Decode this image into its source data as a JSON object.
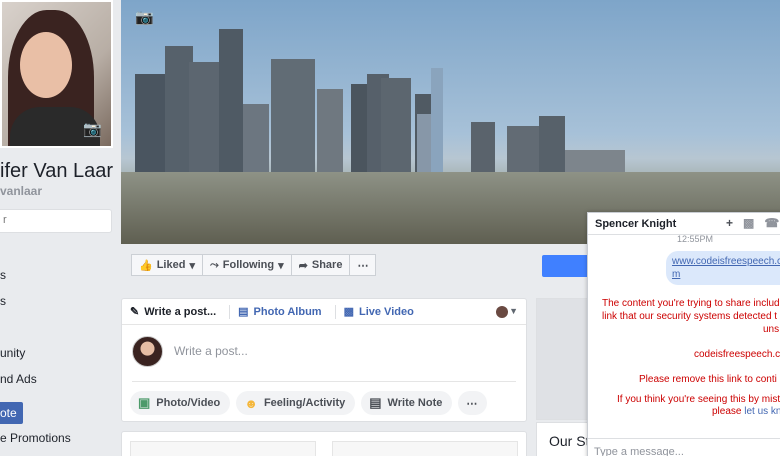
{
  "profile": {
    "name": "ifer Van Laar",
    "handle": "vanlaar",
    "search_placeholder": "r"
  },
  "left_nav": {
    "items": [
      "s",
      "s",
      "",
      "unity",
      "nd Ads"
    ],
    "promote_label": "ote",
    "promotions_label": "e Promotions"
  },
  "actions": {
    "liked": "Liked",
    "following": "Following",
    "share": "Share",
    "more": "⋯"
  },
  "composer": {
    "tab_write": "Write a post...",
    "tab_album": "Photo Album",
    "tab_video": "Live Video",
    "placeholder": "Write a post...",
    "chip_photo": "Photo/Video",
    "chip_feeling": "Feeling/Activity",
    "chip_note": "Write Note",
    "chip_more": "⋯"
  },
  "right_column": {
    "our_story": "Our St"
  },
  "chat": {
    "contact_name": "Spencer Knight",
    "time": "12:55PM",
    "sent_link_line1": "www.codeisfreespeech.c",
    "sent_link_line2": "m",
    "error_line1": "The content you're trying to share include",
    "error_line2": "link that our security systems detected t",
    "error_line3": "uns",
    "error_domain": "codeisfreespeech.c",
    "error_remove": "Please remove this link to conti",
    "error_mistake": "If you think you're seeing this by mista",
    "error_please": "please",
    "error_link": "let us kn",
    "input_placeholder": "Type a message..."
  },
  "colors": {
    "brand_blue": "#4267b2",
    "error_red": "#cc0000",
    "bubble": "#dbe8fb",
    "page_bg": "#e9ebee"
  }
}
